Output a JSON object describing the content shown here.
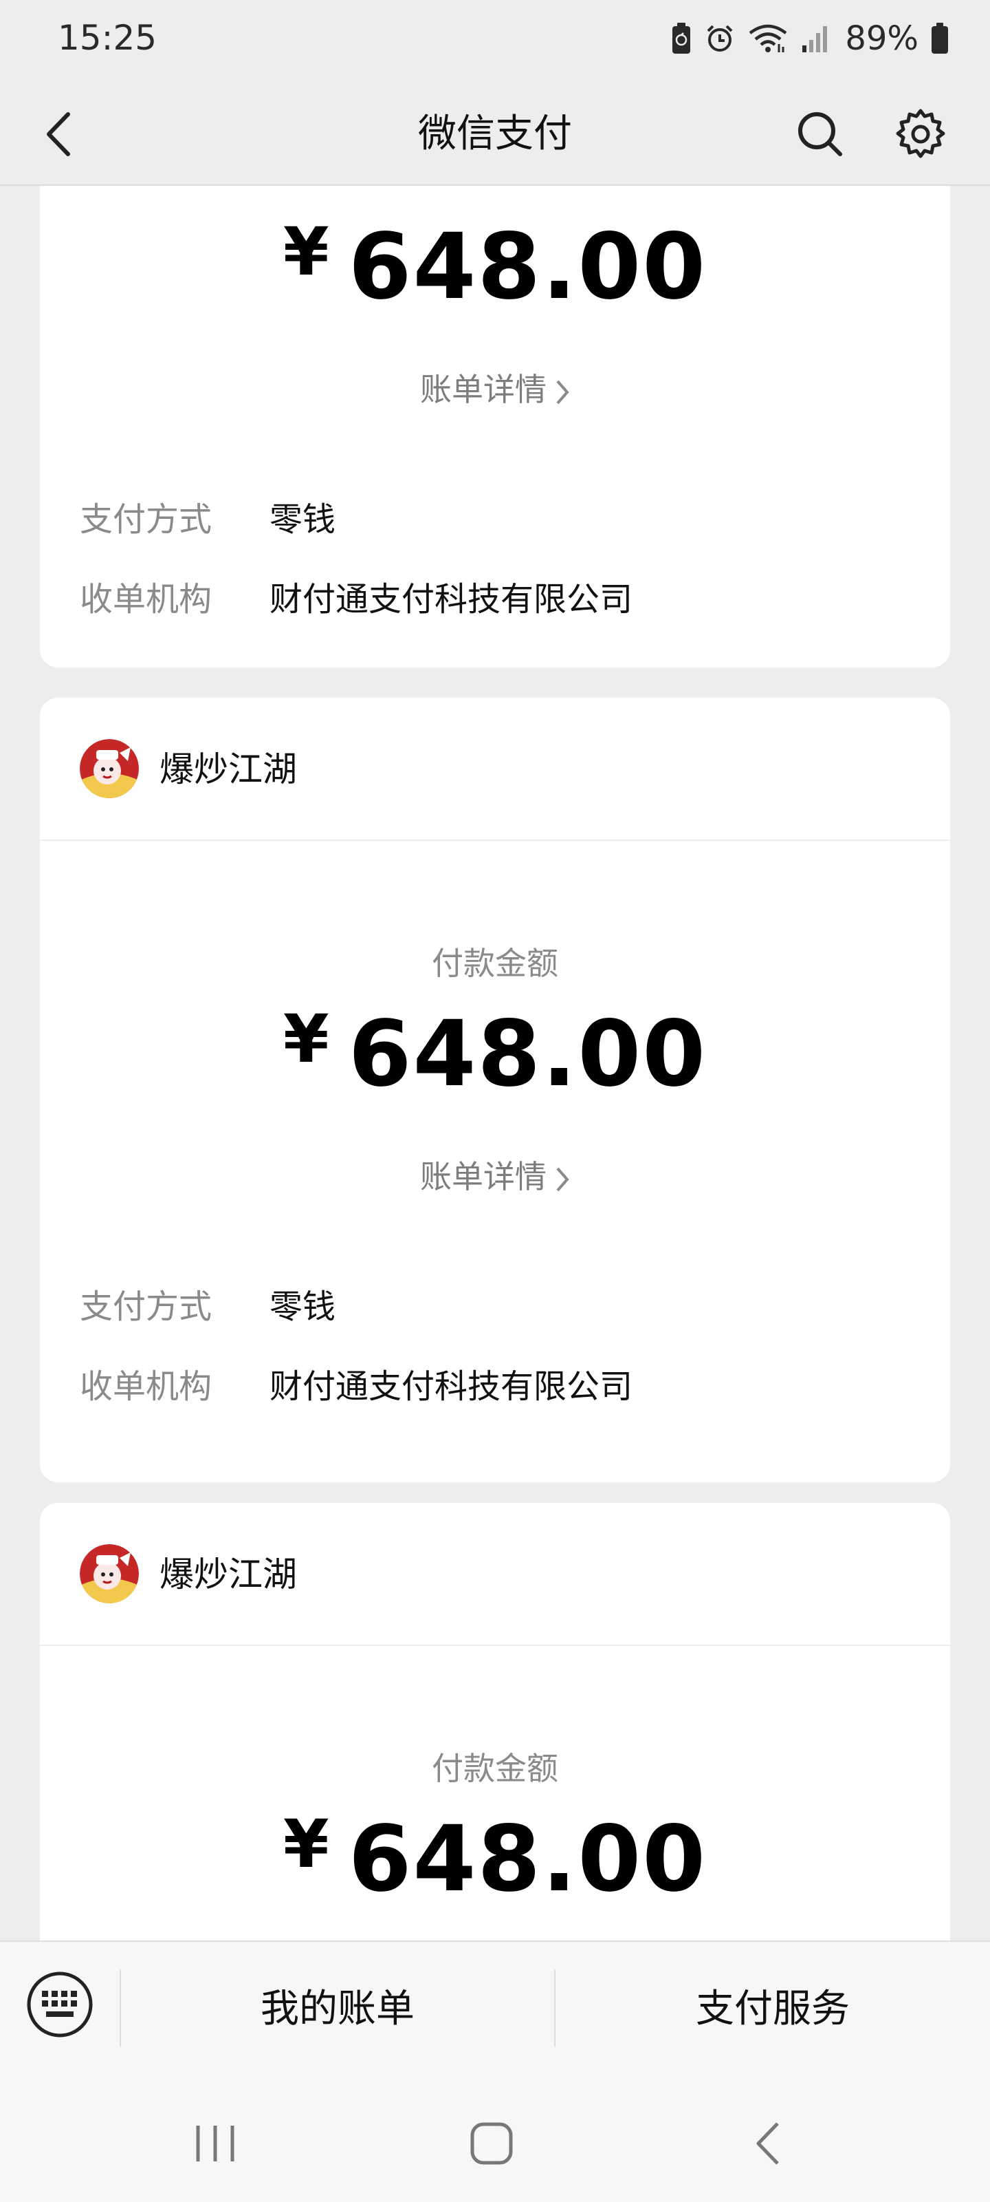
{
  "status_bar": {
    "time": "15:25",
    "battery": "89%",
    "icons": [
      "battery-saver-icon",
      "alarm-icon",
      "wifi-icon",
      "signal-icon",
      "battery-icon"
    ]
  },
  "nav": {
    "title": "微信支付",
    "back_icon": "chevron-left-icon",
    "search_icon": "search-icon",
    "settings_icon": "gear-icon"
  },
  "cards": [
    {
      "merchant": "",
      "amount_label": "",
      "currency": "¥",
      "amount": "648.00",
      "bill_link": "账单详情",
      "details": [
        {
          "label": "支付方式",
          "value": "零钱"
        },
        {
          "label": "收单机构",
          "value": "财付通支付科技有限公司"
        }
      ]
    },
    {
      "merchant": "爆炒江湖",
      "amount_label": "付款金额",
      "currency": "¥",
      "amount": "648.00",
      "bill_link": "账单详情",
      "details": [
        {
          "label": "支付方式",
          "value": "零钱"
        },
        {
          "label": "收单机构",
          "value": "财付通支付科技有限公司"
        }
      ]
    },
    {
      "merchant": "爆炒江湖",
      "amount_label": "付款金额",
      "currency": "¥",
      "amount": "648.00"
    }
  ],
  "bottom_menu": {
    "keyboard_icon": "keyboard-icon",
    "items": [
      "我的账单",
      "支付服务"
    ]
  },
  "android_nav": [
    "recents-icon",
    "home-icon",
    "back-icon"
  ],
  "colors": {
    "background": "#ededed",
    "card": "#ffffff",
    "secondary_text": "#8a8a8a",
    "primary_text": "#111111"
  }
}
